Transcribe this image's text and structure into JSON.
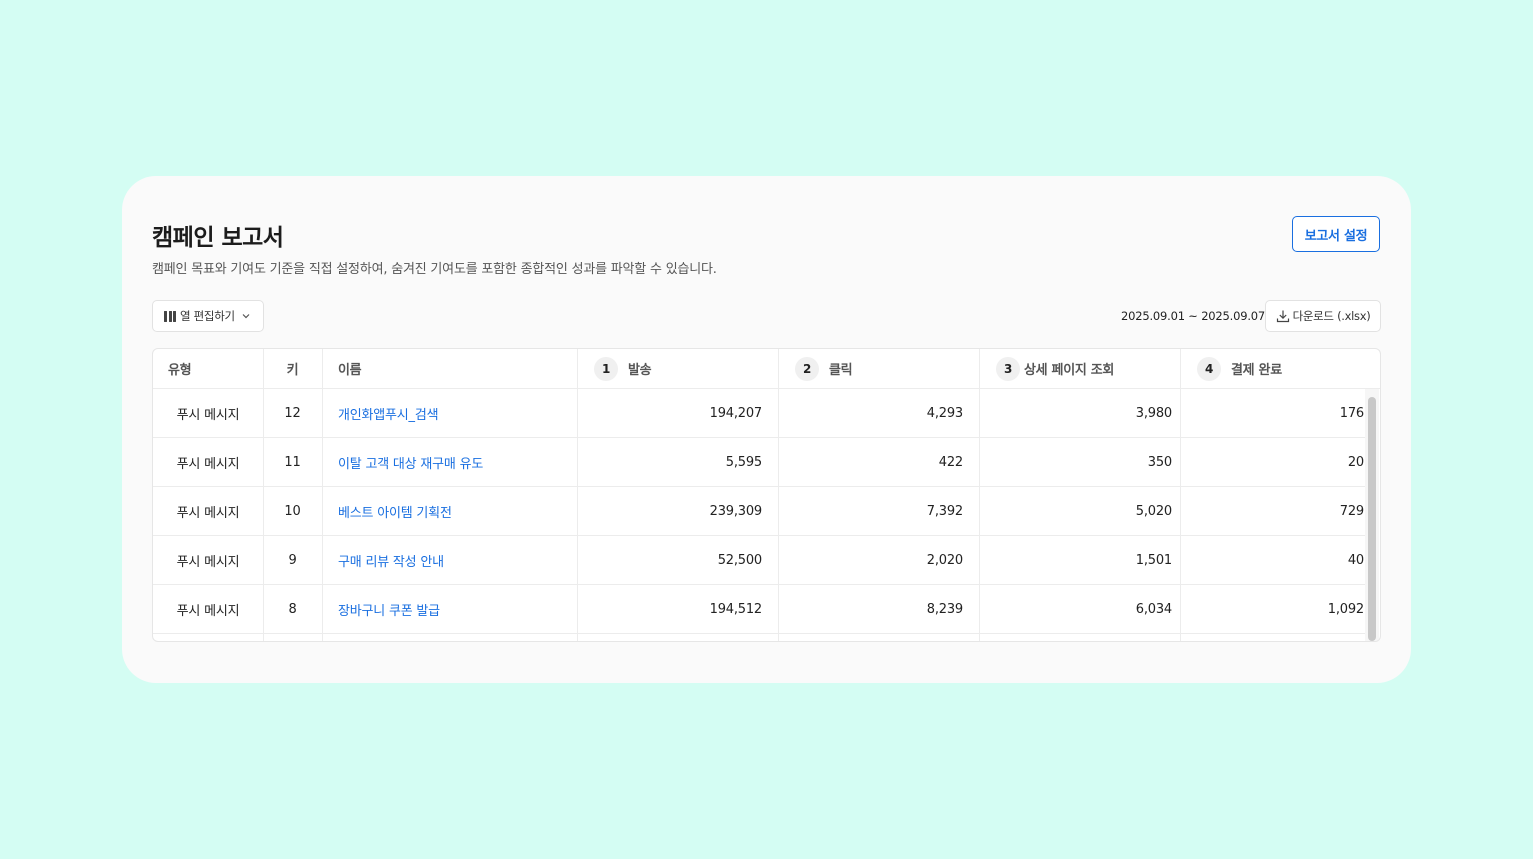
{
  "report": {
    "title": "캠페인 보고서",
    "subtitle": "캠페인 목표와 기여도 기준을 직접 설정하여, 숨겨진 기여도를 포함한 종합적인 성과를 파악할 수 있습니다.",
    "settings_button": "보고서 설정"
  },
  "toolbar": {
    "column_edit_label": "열 편집하기",
    "date_range": "2025.09.01 ~ 2025.09.07",
    "download_label": "다운로드 (.xlsx)"
  },
  "table": {
    "headers": {
      "type": "유형",
      "key": "키",
      "name": "이름",
      "metric1_step": "1",
      "metric1": "발송",
      "metric2_step": "2",
      "metric2": "클릭",
      "metric3_step": "3",
      "metric3": "상세 페이지 조회",
      "metric4_step": "4",
      "metric4": "결제 완료"
    },
    "rows": [
      {
        "type": "푸시 메시지",
        "key": "12",
        "name": "개인화앱푸시_검색",
        "sent": "194,207",
        "clicks": "4,293",
        "detail_views": "3,980",
        "purchases": "176"
      },
      {
        "type": "푸시 메시지",
        "key": "11",
        "name": "이탈 고객 대상 재구매 유도",
        "sent": "5,595",
        "clicks": "422",
        "detail_views": "350",
        "purchases": "20"
      },
      {
        "type": "푸시 메시지",
        "key": "10",
        "name": "베스트 아이템 기획전",
        "sent": "239,309",
        "clicks": "7,392",
        "detail_views": "5,020",
        "purchases": "729"
      },
      {
        "type": "푸시 메시지",
        "key": "9",
        "name": "구매 리뷰 작성 안내",
        "sent": "52,500",
        "clicks": "2,020",
        "detail_views": "1,501",
        "purchases": "40"
      },
      {
        "type": "푸시 메시지",
        "key": "8",
        "name": "장바구니 쿠폰 발급",
        "sent": "194,512",
        "clicks": "8,239",
        "detail_views": "6,034",
        "purchases": "1,092"
      }
    ]
  },
  "colors": {
    "background": "#d4fdf3",
    "accent": "#1a6fe0"
  }
}
